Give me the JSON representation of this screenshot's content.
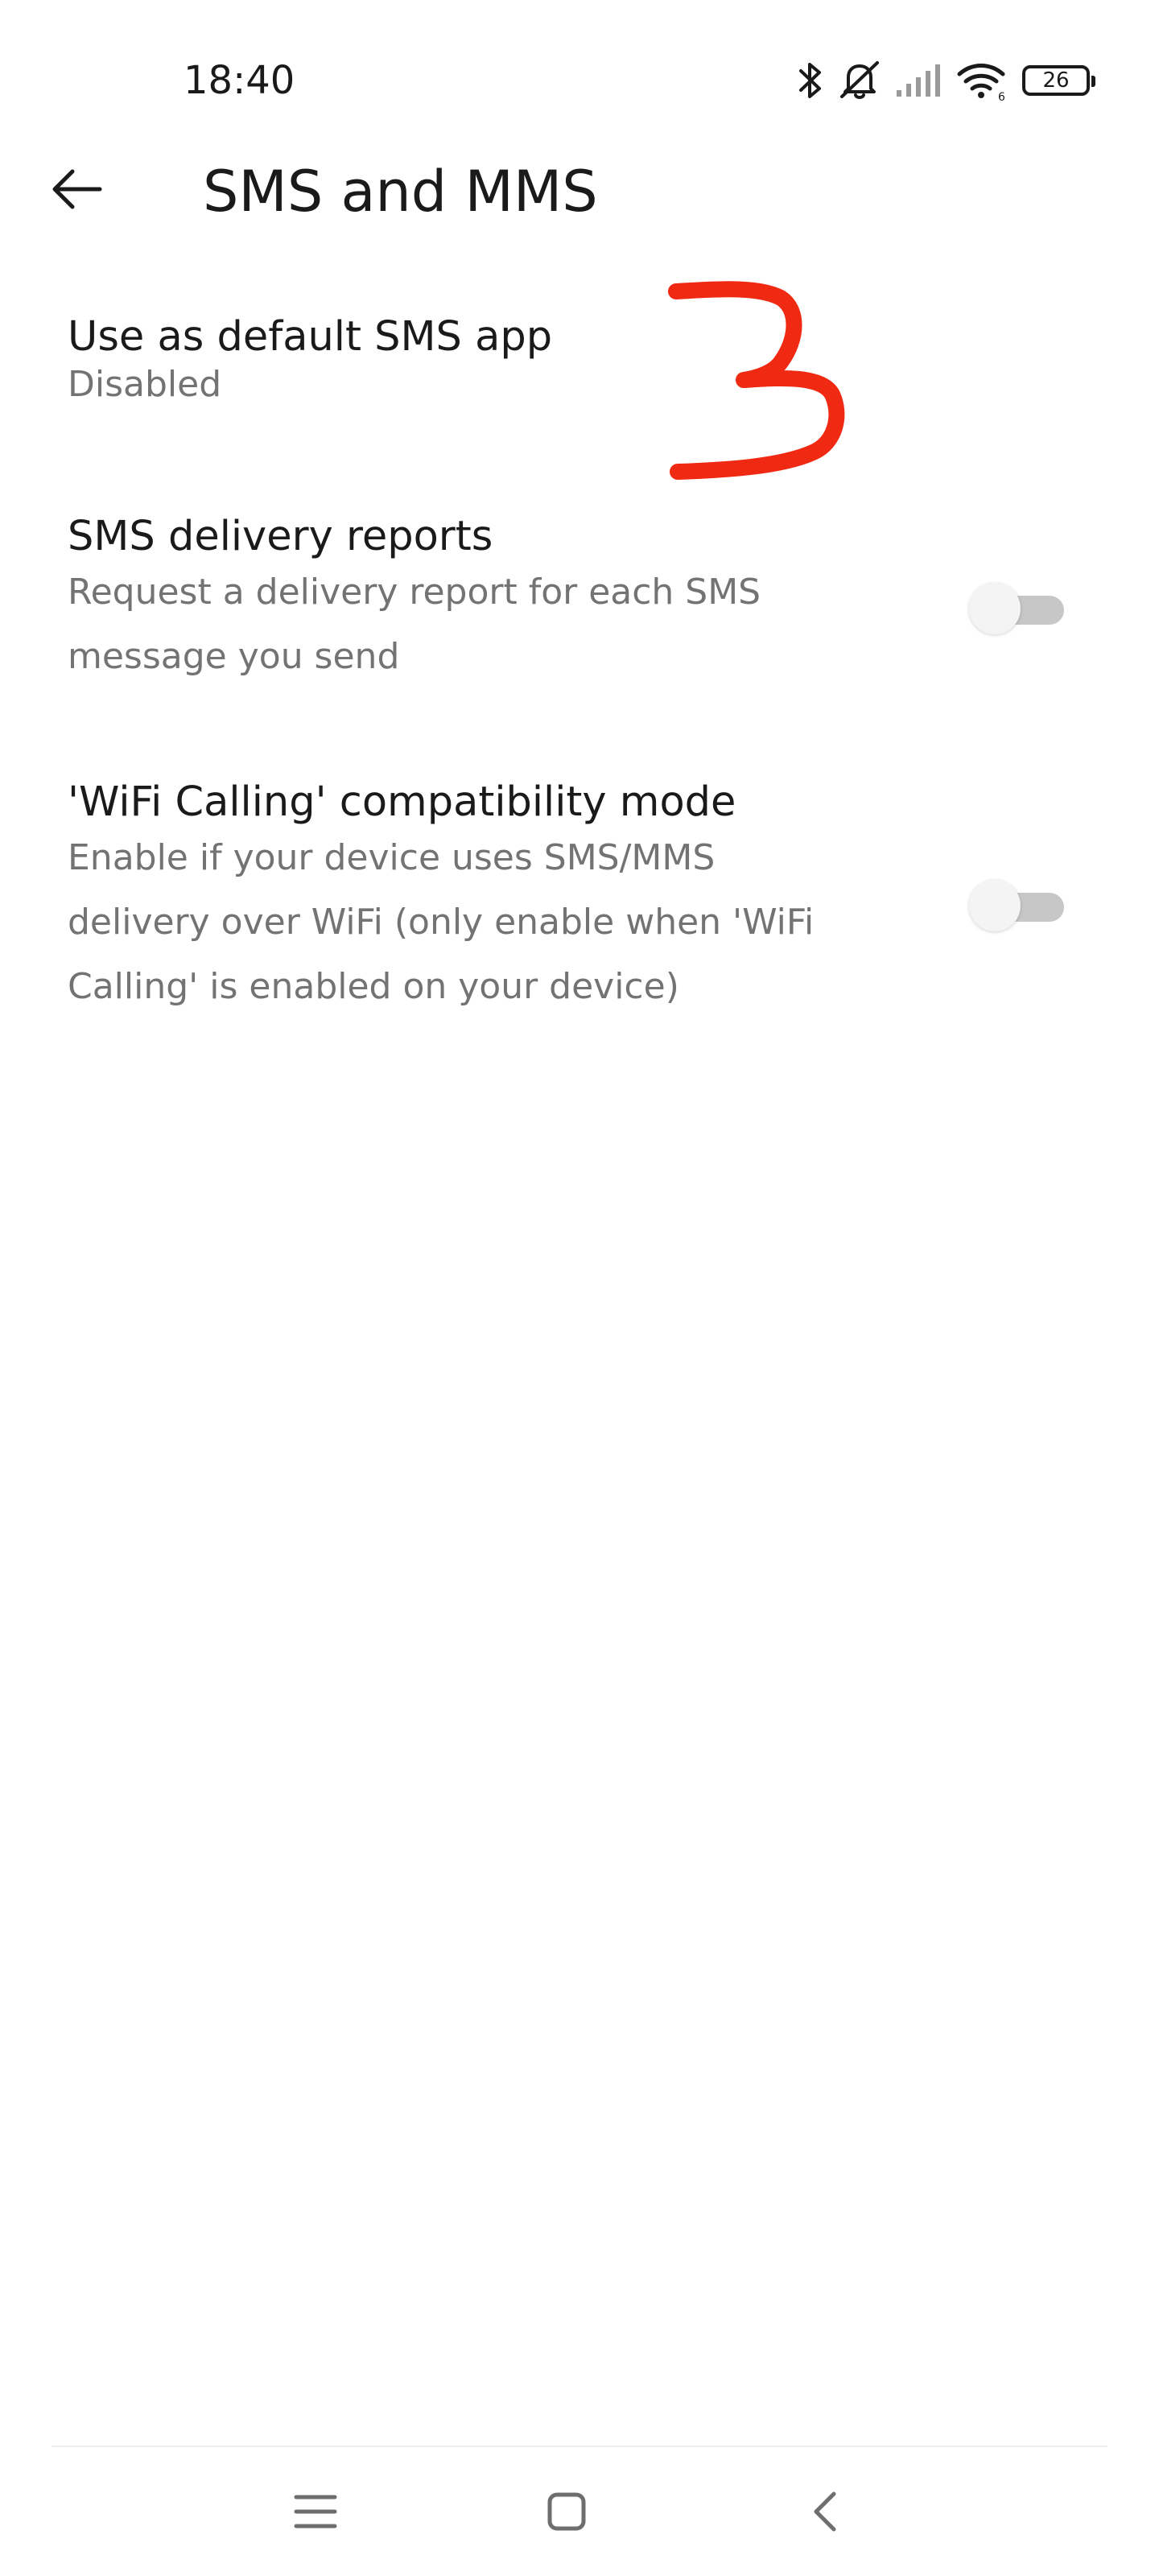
{
  "status_bar": {
    "time": "18:40",
    "icons": [
      "bluetooth-icon",
      "bell-muted-icon",
      "cellular-signal-icon",
      "wifi-6-icon",
      "battery-icon"
    ],
    "battery_level": "26"
  },
  "header": {
    "back_icon": "arrow-left-icon",
    "title": "SMS and MMS"
  },
  "settings": [
    {
      "title": "Use as default SMS app",
      "summary": "Disabled"
    },
    {
      "title": "SMS delivery reports",
      "summary": "Request a delivery report for each SMS message you send",
      "toggle_on": false
    },
    {
      "title": "'WiFi Calling' compatibility mode",
      "summary": "Enable if your device uses SMS/MMS delivery over WiFi (only enable when 'WiFi Calling' is enabled on your device)",
      "toggle_on": false
    }
  ],
  "annotation": {
    "text": "3",
    "color": "#f02a12"
  },
  "nav_bar": {
    "buttons": [
      "menu-icon",
      "home-square-icon",
      "back-chevron-icon"
    ]
  },
  "colors": {
    "background": "#ffffff",
    "text_primary": "#1a1a1a",
    "text_secondary": "#737373",
    "toggle_track_off": "#c7c7c7",
    "toggle_knob": "#f4f4f4"
  }
}
